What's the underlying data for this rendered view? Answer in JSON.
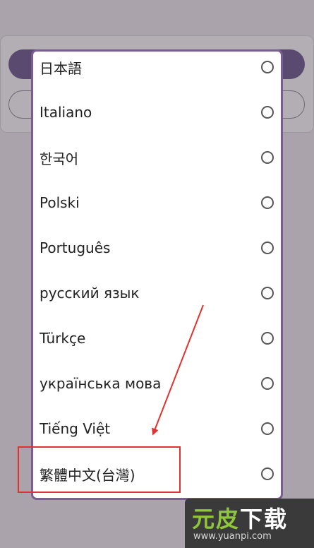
{
  "languages": [
    {
      "label": "日本語",
      "selected": false
    },
    {
      "label": "Italiano",
      "selected": false
    },
    {
      "label": "한국어",
      "selected": false
    },
    {
      "label": "Polski",
      "selected": false
    },
    {
      "label": "Português",
      "selected": false
    },
    {
      "label": "русский язык",
      "selected": false
    },
    {
      "label": "Türkçe",
      "selected": false
    },
    {
      "label": "українська мова",
      "selected": false
    },
    {
      "label": "Tiếng Việt",
      "selected": false
    },
    {
      "label": "繁體中文(台灣)",
      "selected": false
    }
  ],
  "annotation": {
    "highlight_color": "#e0332f",
    "arrow_color": "#e0332f"
  },
  "watermark": {
    "logo_part1": "元皮",
    "logo_part2": "下载",
    "url": "www.yuanpi.com"
  },
  "colors": {
    "dialog_border": "#7a5e93",
    "overlay": "#aaa3ab",
    "accent_pill": "#5b4a70"
  }
}
